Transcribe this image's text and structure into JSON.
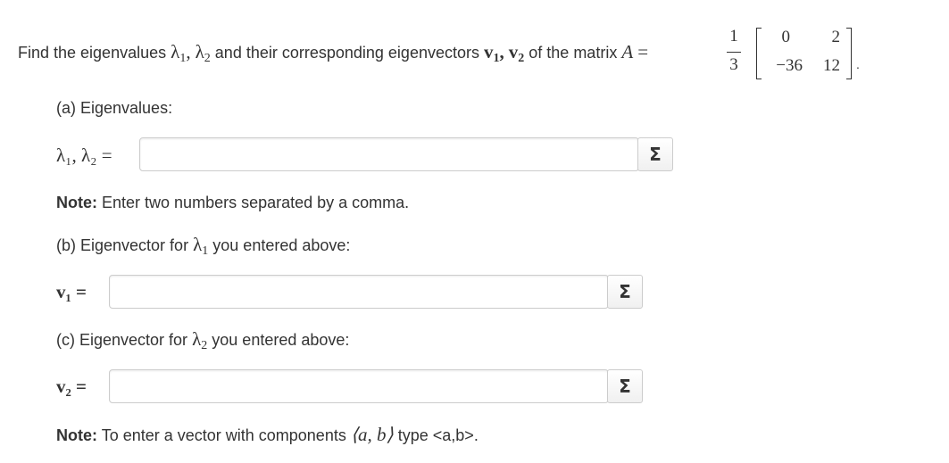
{
  "question": {
    "intro": "Find the eigenvalues",
    "lambda1": "λ",
    "sub1": "1",
    "lambda2": "λ",
    "sub2": "2",
    "mid": "and their corresponding eigenvectors",
    "v": "v",
    "vsub1": "1",
    "vsub2": "2",
    "tail": "of the matrix",
    "A": "A",
    "eq": "=",
    "comma": ",",
    "frac_num": "1",
    "frac_den": "3",
    "matrix": [
      [
        "0",
        "2"
      ],
      [
        "−36",
        "12"
      ]
    ],
    "period": "."
  },
  "part_a": {
    "heading": "(a) Eigenvalues:",
    "label": "λ₁, λ₂ =",
    "input_value": "",
    "sigma": "Σ"
  },
  "note1": {
    "label": "Note:",
    "text": "Enter two numbers separated by a comma."
  },
  "part_b": {
    "heading_prefix": "(b) Eigenvector for",
    "heading_symbol": "λ",
    "heading_sub": "1",
    "heading_suffix": "you entered above:",
    "label": "v₁ =",
    "input_value": "",
    "sigma": "Σ"
  },
  "part_c": {
    "heading_prefix": "(c) Eigenvector for",
    "heading_symbol": "λ",
    "heading_sub": "2",
    "heading_suffix": "you entered above:",
    "label": "v₂ =",
    "input_value": "",
    "sigma": "Σ"
  },
  "note2": {
    "label": "Note:",
    "text_prefix": "To enter a vector with components",
    "math": "⟨a, b⟩",
    "text_suffix": "type <a,b>."
  }
}
